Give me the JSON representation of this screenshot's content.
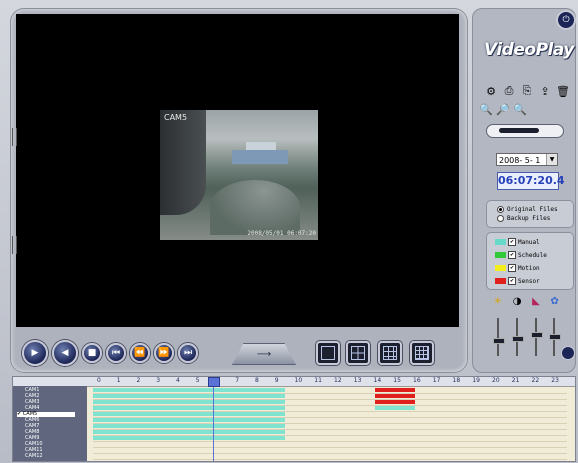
{
  "app": {
    "title": "VideoPlay"
  },
  "video": {
    "cam_label": "CAM5",
    "timestamp": "2008/05/01 06:07:20"
  },
  "controls": {
    "speed_label": "⟶"
  },
  "datetime": {
    "date": "2008- 5- 1",
    "time": "06:07:20.4"
  },
  "source": {
    "options": [
      "Original Files",
      "Backup Files"
    ],
    "selected": "Original Files"
  },
  "legend": {
    "items": [
      {
        "label": "Manual",
        "color": "#66d9c8",
        "checked": true
      },
      {
        "label": "Schedule",
        "color": "#31c83a",
        "checked": true
      },
      {
        "label": "Motion",
        "color": "#f3ef1d",
        "checked": true
      },
      {
        "label": "Sensor",
        "color": "#e0201c",
        "checked": true
      }
    ]
  },
  "timeline": {
    "hours": [
      "0",
      "1",
      "2",
      "3",
      "4",
      "5",
      "6",
      "7",
      "8",
      "9",
      "10",
      "11",
      "12",
      "13",
      "14",
      "15",
      "16",
      "17",
      "18",
      "19",
      "20",
      "21",
      "22",
      "23"
    ],
    "cameras": [
      "CAM1",
      "CAM2",
      "CAM3",
      "CAM4",
      "CAM5",
      "CAM6",
      "CAM7",
      "CAM8",
      "CAM9",
      "CAM10",
      "CAM11",
      "CAM12"
    ],
    "selected_camera": "CAM5",
    "playhead_hour": 6.1,
    "manual_color": "#7fe3cf",
    "sensor_color": "#e0201c"
  }
}
